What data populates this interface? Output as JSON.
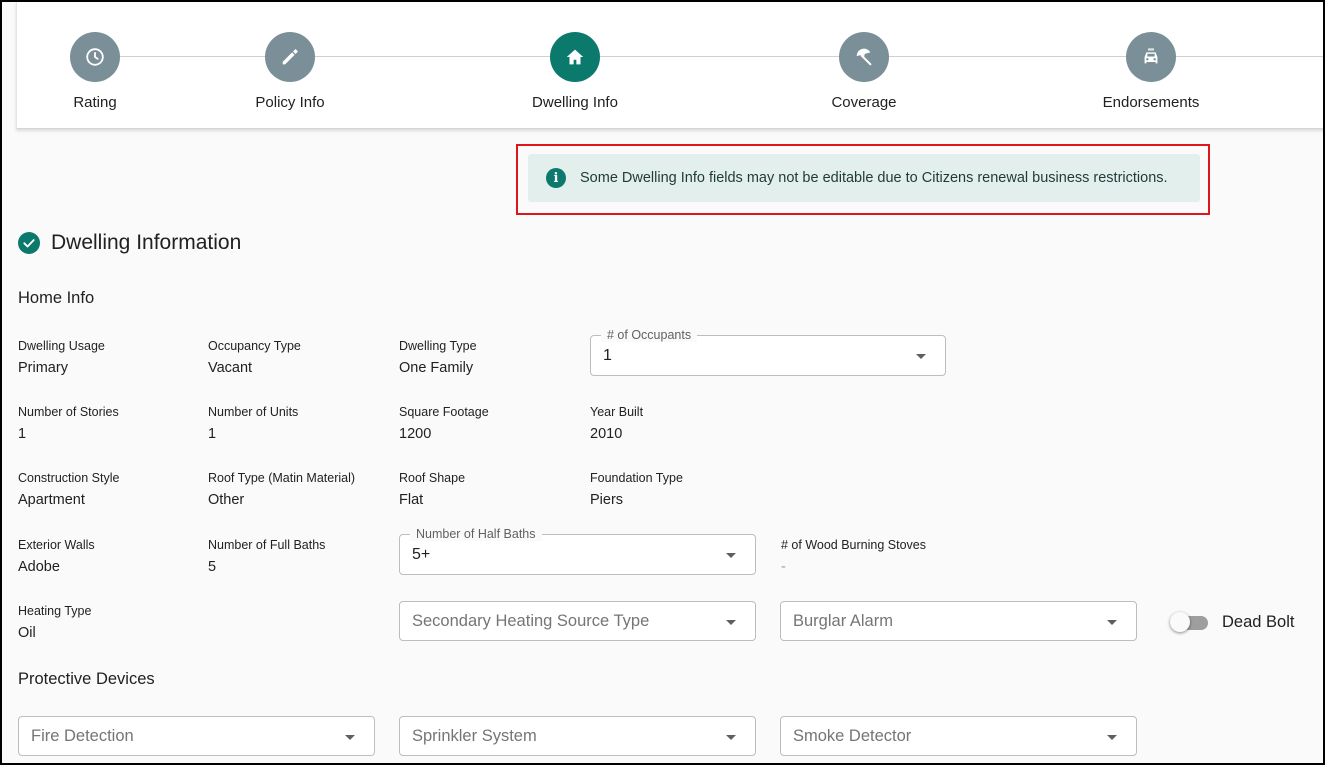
{
  "stepper": {
    "steps": [
      {
        "label": "Rating",
        "icon": "clock-icon",
        "active": false
      },
      {
        "label": "Policy Info",
        "icon": "pencil-icon",
        "active": false
      },
      {
        "label": "Dwelling Info",
        "icon": "home-icon",
        "active": true
      },
      {
        "label": "Coverage",
        "icon": "umbrella-icon",
        "active": false
      },
      {
        "label": "Endorsements",
        "icon": "car-icon",
        "active": false
      }
    ]
  },
  "alert": {
    "icon": "info-icon",
    "icon_glyph": "i",
    "text": "Some Dwelling Info fields may not be editable due to Citizens renewal business restrictions."
  },
  "section": {
    "title": "Dwelling Information",
    "icon": "check-circle-icon"
  },
  "home_info": {
    "heading": "Home Info",
    "dwelling_usage": {
      "label": "Dwelling Usage",
      "value": "Primary"
    },
    "occupancy_type": {
      "label": "Occupancy Type",
      "value": "Vacant"
    },
    "dwelling_type": {
      "label": "Dwelling Type",
      "value": "One Family"
    },
    "occupants": {
      "label": "# of Occupants",
      "value": "1"
    },
    "number_of_stories": {
      "label": "Number of Stories",
      "value": "1"
    },
    "number_of_units": {
      "label": "Number of Units",
      "value": "1"
    },
    "square_footage": {
      "label": "Square Footage",
      "value": "1200"
    },
    "year_built": {
      "label": "Year Built",
      "value": "2010"
    },
    "construction_style": {
      "label": "Construction Style",
      "value": "Apartment"
    },
    "roof_type": {
      "label": "Roof Type (Matin Material)",
      "value": "Other"
    },
    "roof_shape": {
      "label": "Roof Shape",
      "value": "Flat"
    },
    "foundation_type": {
      "label": "Foundation Type",
      "value": "Piers"
    },
    "exterior_walls": {
      "label": "Exterior Walls",
      "value": "Adobe"
    },
    "full_baths": {
      "label": "Number of Full Baths",
      "value": "5"
    },
    "half_baths": {
      "label": "Number of Half Baths",
      "value": "5+"
    },
    "wood_stoves": {
      "label": "# of Wood Burning Stoves",
      "value": "-"
    },
    "heating_type": {
      "label": "Heating Type",
      "value": "Oil"
    },
    "secondary_heating": {
      "placeholder": "Secondary Heating Source Type"
    },
    "burglar_alarm": {
      "placeholder": "Burglar Alarm"
    },
    "dead_bolt": {
      "label": "Dead Bolt",
      "checked": false
    }
  },
  "protective_devices": {
    "heading": "Protective Devices",
    "fire_detection": {
      "placeholder": "Fire Detection"
    },
    "sprinkler_system": {
      "placeholder": "Sprinkler System"
    },
    "smoke_detector": {
      "placeholder": "Smoke Detector"
    }
  },
  "colors": {
    "accent": "#0b7a6d",
    "step_inactive": "#7b8f98",
    "alert_bg": "#e3efed",
    "highlight_outline": "#e0151b"
  }
}
